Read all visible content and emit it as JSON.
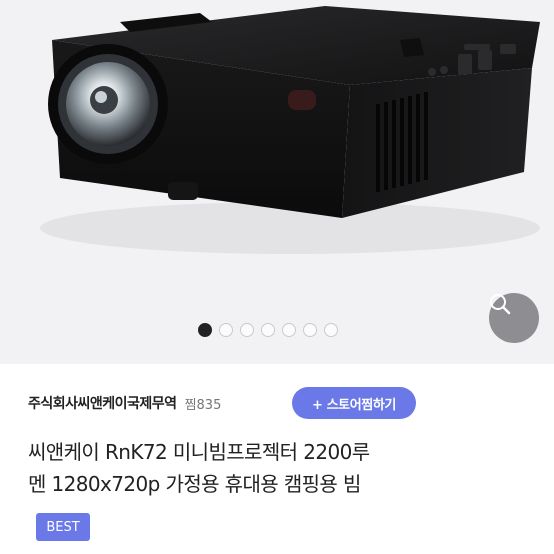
{
  "gallery": {
    "total_images": 7,
    "active_index": 0
  },
  "seller": {
    "name": "주식회사씨앤케이국제무역",
    "wish_count": "찜835",
    "store_button_label": "+ 스토어찜하기"
  },
  "product": {
    "title_line1": "씨앤케이 RnK72 미니빔프로젝터 2200루",
    "title_line2": "멘 1280x720p 가정용 휴대용 캠핑용 빔",
    "badge": "BEST"
  },
  "icons": {
    "search": "search-icon"
  },
  "colors": {
    "accent": "#6b79e8",
    "search_bg": "#8e8e92",
    "hero_bg": "#f2f2f4"
  }
}
